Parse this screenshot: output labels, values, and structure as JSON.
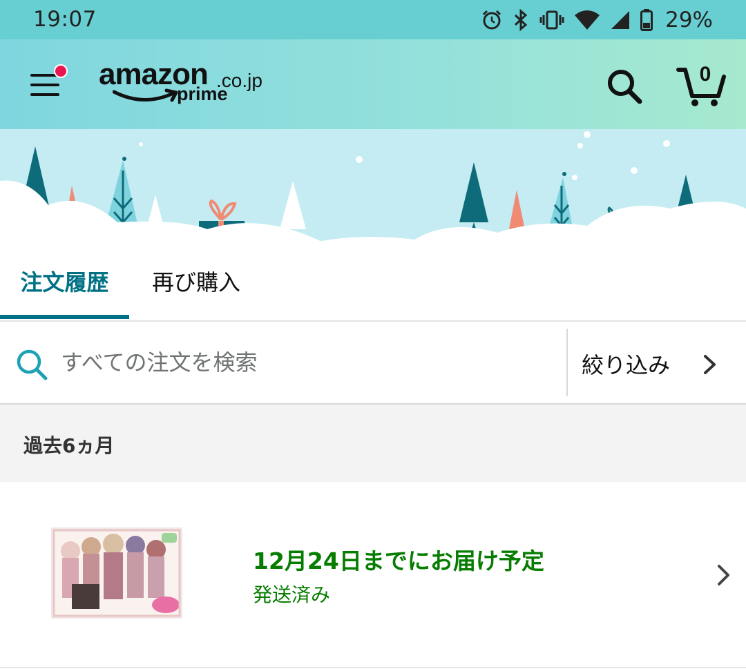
{
  "status_bar": {
    "time": "19:07",
    "battery_percent": "29%",
    "icons": [
      "alarm-icon",
      "bluetooth-icon",
      "vibrate-icon",
      "wifi-icon",
      "cell-signal-icon",
      "battery-icon"
    ]
  },
  "header": {
    "logo_text": "amazon",
    "logo_tld": ".co.jp",
    "logo_prime": "prime",
    "cart_count": "0",
    "menu_has_notification": true
  },
  "tabs": [
    {
      "label": "注文履歴",
      "active": true
    },
    {
      "label": "再び購入",
      "active": false
    }
  ],
  "search": {
    "placeholder": "すべての注文を検索",
    "filter_label": "絞り込み"
  },
  "section": {
    "title": "過去6ヵ月"
  },
  "orders": [
    {
      "title": "12月24日までにお届け予定",
      "status": "発送済み"
    }
  ],
  "colors": {
    "status_bar": "#67cfd2",
    "header_start": "#7fd6de",
    "header_end": "#a6e9cf",
    "accent_teal": "#007185",
    "delivery_green": "#067d00",
    "notification_dot": "#e8174f"
  }
}
